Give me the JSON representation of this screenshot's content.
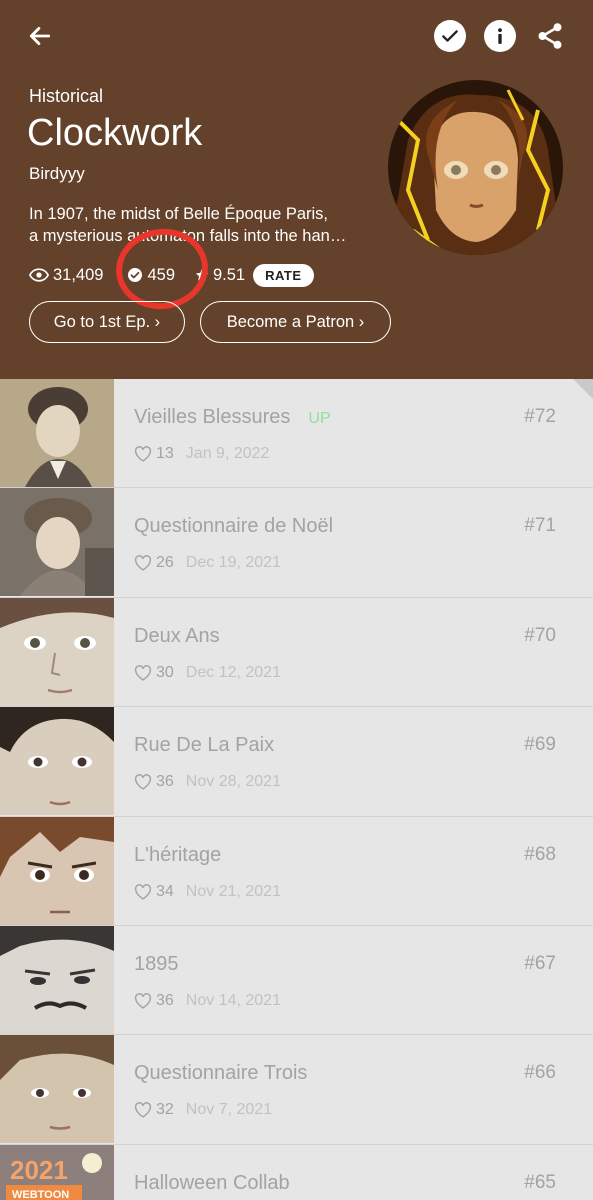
{
  "colors": {
    "header_bg": "#64412b",
    "annotation_circle": "#e8362b",
    "up_badge": "#8fe09a",
    "list_bg": "#e6e6e6"
  },
  "header": {
    "icons": {
      "back": "back-arrow-icon",
      "subscribed": "checkmark-icon",
      "info": "info-icon",
      "share": "share-icon"
    },
    "genre": "Historical",
    "title": "Clockwork",
    "author": "Birdyyy",
    "summary_line1": "In 1907, the midst of Belle Époque Paris,",
    "summary_line2": "a mysterious automaton falls into the han…",
    "stats": {
      "views": "31,409",
      "subscribers": "459",
      "rating": "9.51",
      "rate_label": "RATE"
    },
    "buttons": {
      "first_episode": "Go to 1st Ep. ›",
      "patron": "Become a Patron ›"
    }
  },
  "episodes": [
    {
      "title": "Vieilles Blessures",
      "badge": "UP",
      "likes": "13",
      "date": "Jan 9, 2022",
      "number": "#72"
    },
    {
      "title": "Questionnaire de Noël",
      "badge": "",
      "likes": "26",
      "date": "Dec 19, 2021",
      "number": "#71"
    },
    {
      "title": "Deux Ans",
      "badge": "",
      "likes": "30",
      "date": "Dec 12, 2021",
      "number": "#70"
    },
    {
      "title": "Rue De La Paix",
      "badge": "",
      "likes": "36",
      "date": "Nov 28, 2021",
      "number": "#69"
    },
    {
      "title": "L'héritage",
      "badge": "",
      "likes": "34",
      "date": "Nov 21, 2021",
      "number": "#68"
    },
    {
      "title": "1895",
      "badge": "",
      "likes": "36",
      "date": "Nov 14, 2021",
      "number": "#67"
    },
    {
      "title": "Questionnaire Trois",
      "badge": "",
      "likes": "32",
      "date": "Nov 7, 2021",
      "number": "#66"
    },
    {
      "title": "Halloween Collab",
      "badge": "",
      "likes": "",
      "date": "",
      "number": "#65",
      "thumb_text": "2021",
      "thumb_subtext": "WEBTOON"
    }
  ]
}
